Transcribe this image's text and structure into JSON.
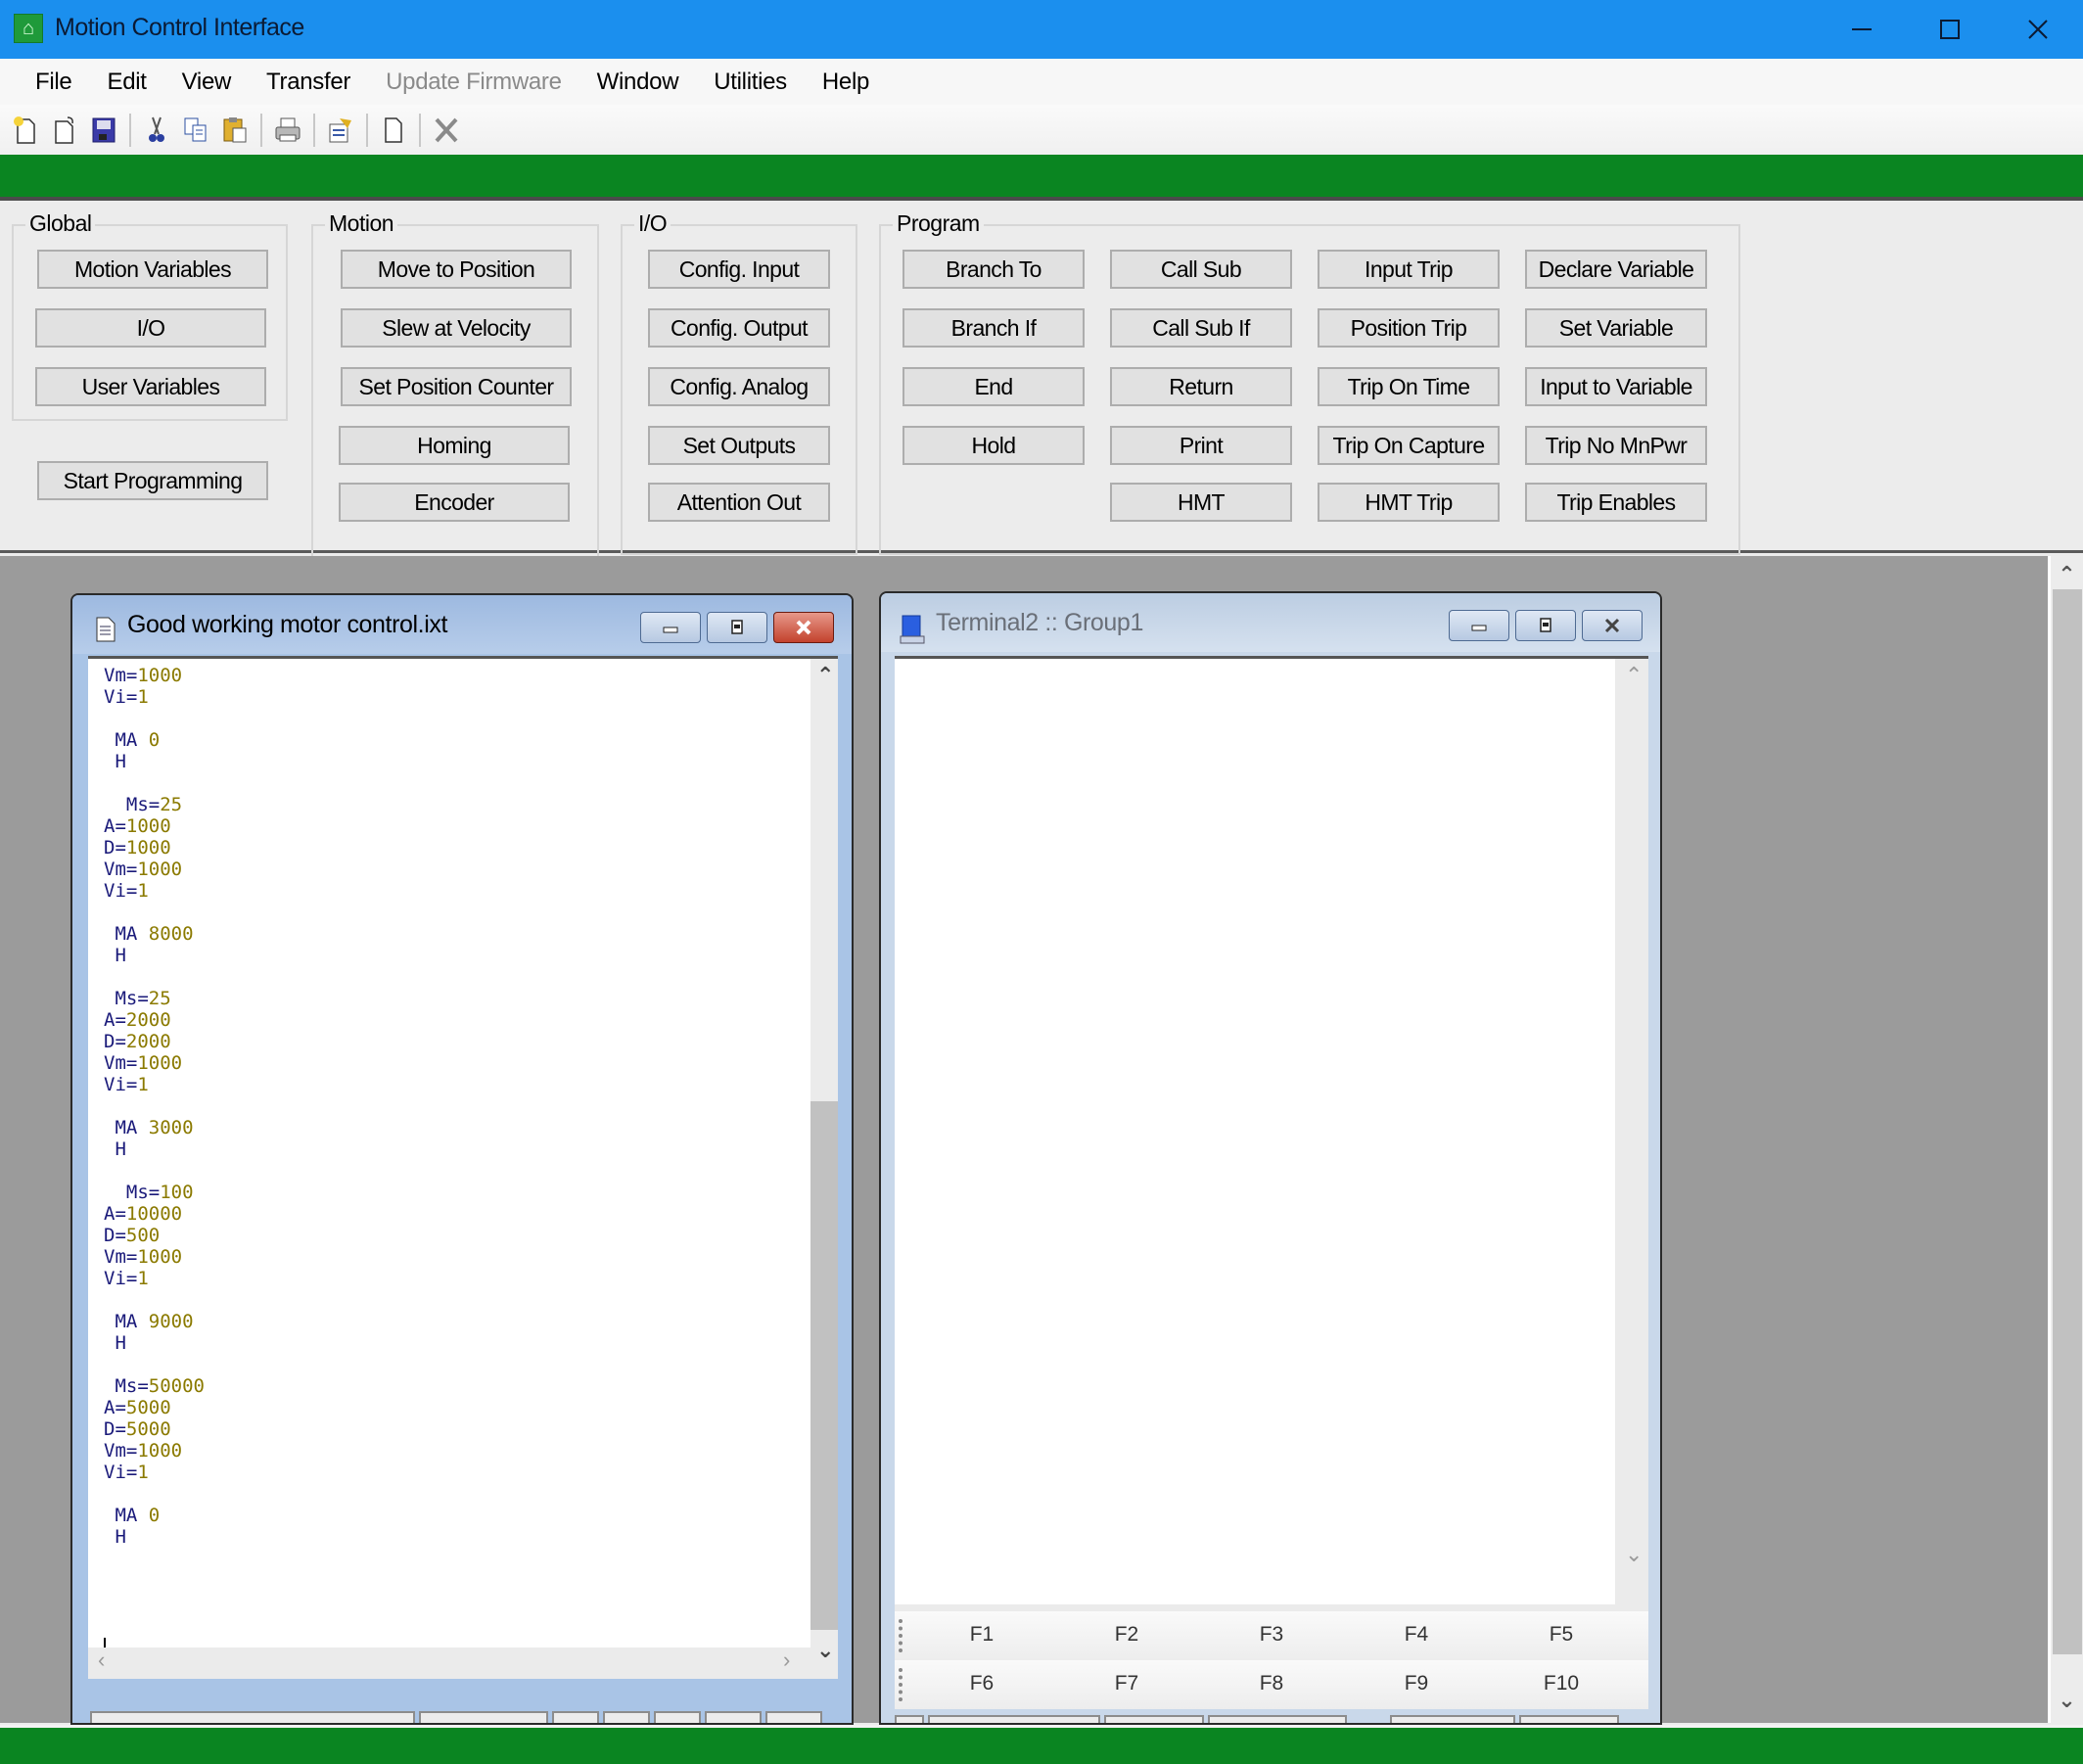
{
  "window": {
    "title": "Motion Control Interface",
    "app_icon": "app-logo-icon",
    "controls": [
      "minimize-icon",
      "maximize-icon",
      "close-icon"
    ]
  },
  "menu": {
    "items": [
      {
        "label": "File",
        "enabled": true
      },
      {
        "label": "Edit",
        "enabled": true
      },
      {
        "label": "View",
        "enabled": true
      },
      {
        "label": "Transfer",
        "enabled": true
      },
      {
        "label": "Update Firmware",
        "enabled": false
      },
      {
        "label": "Window",
        "enabled": true
      },
      {
        "label": "Utilities",
        "enabled": true
      },
      {
        "label": "Help",
        "enabled": true
      }
    ]
  },
  "toolbar": {
    "buttons": [
      "new-file-icon",
      "open-file-icon",
      "save-icon",
      "cut-icon",
      "copy-icon",
      "paste-icon",
      "print-icon",
      "properties-icon",
      "blank-page-icon",
      "delete-icon"
    ]
  },
  "panel": {
    "global": {
      "label": "Global",
      "buttons": [
        "Motion Variables",
        "I/O",
        "User Variables"
      ],
      "start_programming": "Start Programming"
    },
    "motion": {
      "label": "Motion",
      "buttons": [
        "Move to Position",
        "Slew at Velocity",
        "Set Position Counter",
        "Homing",
        "Encoder"
      ]
    },
    "io": {
      "label": "I/O",
      "buttons": [
        "Config. Input",
        "Config. Output",
        "Config. Analog",
        "Set Outputs",
        "Attention Out"
      ]
    },
    "program": {
      "label": "Program",
      "col1": [
        "Branch To",
        "Branch If",
        "End",
        "Hold"
      ],
      "col2": [
        "Call Sub",
        "Call Sub If",
        "Return",
        "Print",
        "HMT"
      ],
      "col3": [
        "Input Trip",
        "Position Trip",
        "Trip On Time",
        "Trip On Capture",
        "HMT Trip"
      ],
      "col4": [
        "Declare Variable",
        "Set Variable",
        "Input to Variable",
        "Trip No MnPwr",
        "Trip Enables"
      ]
    }
  },
  "editor_window": {
    "title": "Good working motor control.ixt",
    "icon": "document-icon",
    "lines": [
      {
        "indent": "",
        "kw": "Vm=",
        "val": "1000"
      },
      {
        "indent": "",
        "kw": "Vi=",
        "val": "1"
      },
      {
        "indent": "",
        "kw": "",
        "val": ""
      },
      {
        "indent": " ",
        "kw": "MA ",
        "val": "0"
      },
      {
        "indent": " ",
        "kw": "H",
        "val": ""
      },
      {
        "indent": "",
        "kw": "",
        "val": ""
      },
      {
        "indent": "  ",
        "kw": "Ms=",
        "val": "25"
      },
      {
        "indent": "",
        "kw": "A=",
        "val": "1000"
      },
      {
        "indent": "",
        "kw": "D=",
        "val": "1000"
      },
      {
        "indent": "",
        "kw": "Vm=",
        "val": "1000"
      },
      {
        "indent": "",
        "kw": "Vi=",
        "val": "1"
      },
      {
        "indent": "",
        "kw": "",
        "val": ""
      },
      {
        "indent": " ",
        "kw": "MA ",
        "val": "8000"
      },
      {
        "indent": " ",
        "kw": "H",
        "val": ""
      },
      {
        "indent": "",
        "kw": "",
        "val": ""
      },
      {
        "indent": " ",
        "kw": "Ms=",
        "val": "25"
      },
      {
        "indent": "",
        "kw": "A=",
        "val": "2000"
      },
      {
        "indent": "",
        "kw": "D=",
        "val": "2000"
      },
      {
        "indent": "",
        "kw": "Vm=",
        "val": "1000"
      },
      {
        "indent": "",
        "kw": "Vi=",
        "val": "1"
      },
      {
        "indent": "",
        "kw": "",
        "val": ""
      },
      {
        "indent": " ",
        "kw": "MA ",
        "val": "3000"
      },
      {
        "indent": " ",
        "kw": "H",
        "val": ""
      },
      {
        "indent": "",
        "kw": "",
        "val": ""
      },
      {
        "indent": "  ",
        "kw": "Ms=",
        "val": "100"
      },
      {
        "indent": "",
        "kw": "A=",
        "val": "10000"
      },
      {
        "indent": "",
        "kw": "D=",
        "val": "500"
      },
      {
        "indent": "",
        "kw": "Vm=",
        "val": "1000"
      },
      {
        "indent": "",
        "kw": "Vi=",
        "val": "1"
      },
      {
        "indent": "",
        "kw": "",
        "val": ""
      },
      {
        "indent": " ",
        "kw": "MA ",
        "val": "9000"
      },
      {
        "indent": " ",
        "kw": "H",
        "val": ""
      },
      {
        "indent": "",
        "kw": "",
        "val": ""
      },
      {
        "indent": " ",
        "kw": "Ms=",
        "val": "50000"
      },
      {
        "indent": "",
        "kw": "A=",
        "val": "5000"
      },
      {
        "indent": "",
        "kw": "D=",
        "val": "5000"
      },
      {
        "indent": "",
        "kw": "Vm=",
        "val": "1000"
      },
      {
        "indent": "",
        "kw": "Vi=",
        "val": "1"
      },
      {
        "indent": "",
        "kw": "",
        "val": ""
      },
      {
        "indent": " ",
        "kw": "MA ",
        "val": "0"
      },
      {
        "indent": " ",
        "kw": "H",
        "val": ""
      }
    ]
  },
  "terminal_window": {
    "title": "Terminal2 :: Group1",
    "icon": "terminal-icon",
    "function_keys_row1": [
      "F1",
      "F2",
      "F3",
      "F4",
      "F5"
    ],
    "function_keys_row2": [
      "F6",
      "F7",
      "F8",
      "F9",
      "F10"
    ]
  },
  "colors": {
    "titlebar": "#1b8fee",
    "green_bar": "#0a8521",
    "mdi_background": "#9b9b9b",
    "code_keyword": "#1a1a7a",
    "code_number": "#8b7a00"
  }
}
